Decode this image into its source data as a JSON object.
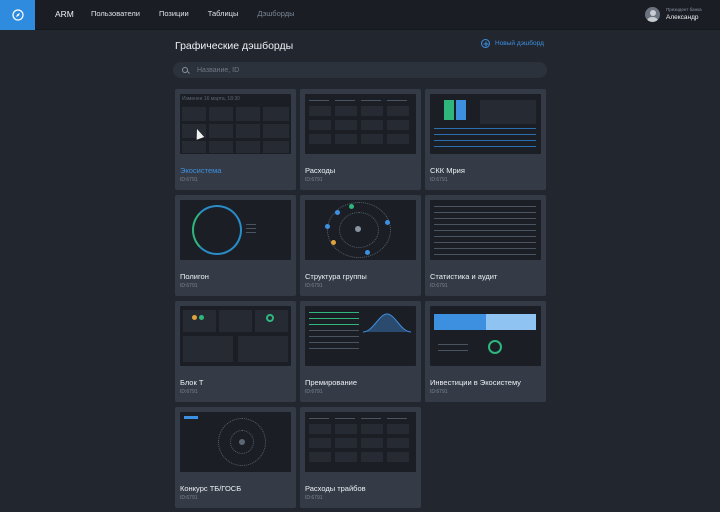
{
  "topbar": {
    "brand": "ARM",
    "nav": [
      {
        "label": "Пользователи",
        "active": false
      },
      {
        "label": "Позиции",
        "active": false
      },
      {
        "label": "Таблицы",
        "active": false
      },
      {
        "label": "Дэшборды",
        "active": true
      }
    ],
    "user": {
      "role": "Президент банка",
      "name": "Александр"
    },
    "logo_icon": "compass-icon"
  },
  "header": {
    "title": "Графические дэшборды",
    "new_dashboard": "Новый дэшборд"
  },
  "search": {
    "placeholder": "Название, ID",
    "value": ""
  },
  "cards": [
    {
      "title": "Экосистема",
      "id": "ID:6791",
      "active": true,
      "thumb_caption": "Изменен 16 марта, 18:30"
    },
    {
      "title": "Расходы",
      "id": "ID:6791"
    },
    {
      "title": "СКК Мрия",
      "id": "ID:6791"
    },
    {
      "title": "Полигон",
      "id": "ID:6791"
    },
    {
      "title": "Структура группы",
      "id": "ID:6791"
    },
    {
      "title": "Статистика и аудит",
      "id": "ID:6791"
    },
    {
      "title": "Блок Т",
      "id": "ID:6791"
    },
    {
      "title": "Премирование",
      "id": "ID:6791"
    },
    {
      "title": "Инвестиции в Экосистему",
      "id": "ID:6791"
    },
    {
      "title": "Конкурс ТБ/ГОСБ",
      "id": "ID:6791"
    },
    {
      "title": "Расходы трайбов",
      "id": "ID:6791"
    }
  ],
  "colors": {
    "accent": "#3d8fe0",
    "background": "#22272f",
    "card": "#343b46",
    "topbar": "#1a1d23"
  }
}
